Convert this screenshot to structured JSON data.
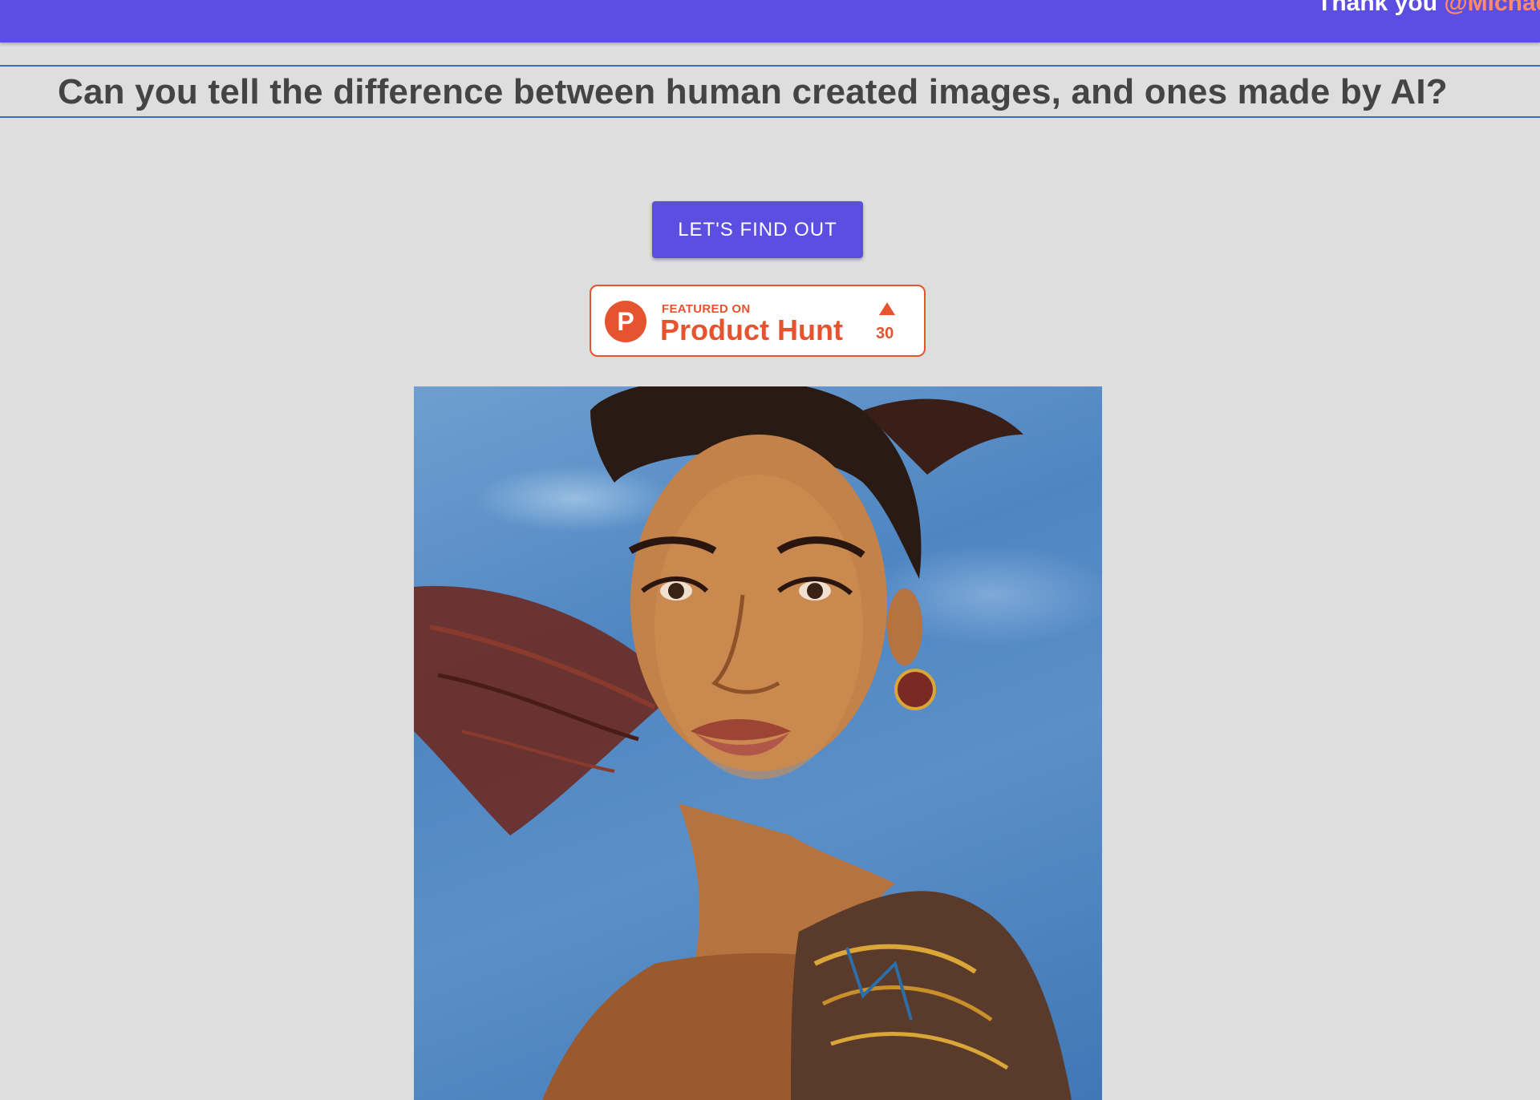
{
  "header": {
    "thanks_prefix": "Thank you ",
    "thanks_handle": "@Michael"
  },
  "page": {
    "title": "Can you tell the difference between human created images, and ones made by AI?"
  },
  "cta": {
    "label": "LET'S FIND OUT"
  },
  "product_hunt_badge": {
    "logo_letter": "P",
    "featured_label": "FEATURED ON",
    "name": "Product Hunt",
    "upvotes": "30"
  },
  "colors": {
    "brand": "#5b4ee0",
    "title_rule": "#2f6fcf",
    "background": "#dedede",
    "product_hunt": "#e5532f",
    "handle": "#ff8a6a"
  }
}
